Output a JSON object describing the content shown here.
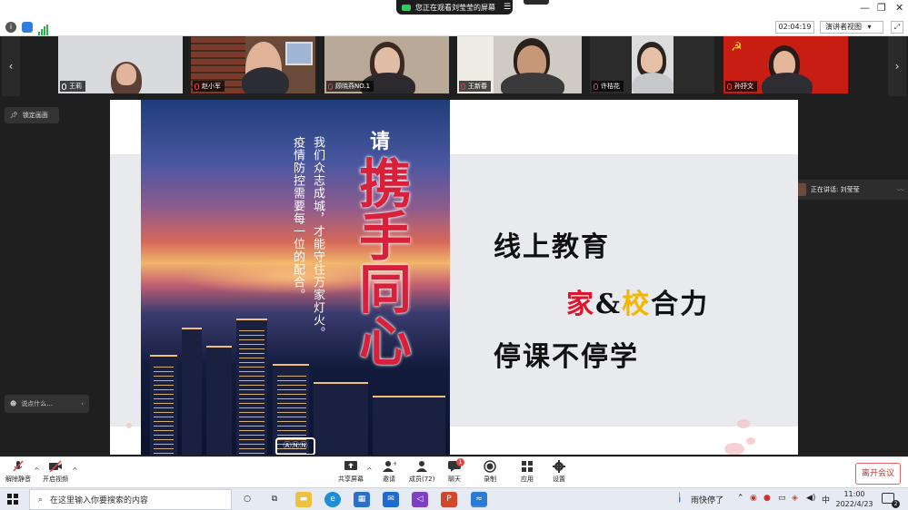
{
  "share_banner": {
    "text": "您正在观看刘莹莹的屏幕",
    "menu_icon": "hamburger-icon"
  },
  "toolbar_top": {
    "timer": "02:04:19",
    "view_label": "演讲者视图"
  },
  "gallery": {
    "participants": [
      {
        "name": "王莉",
        "muted": false,
        "bg": "#d7d9dc"
      },
      {
        "name": "赵小军",
        "muted": true,
        "bg": "#6a4b3a"
      },
      {
        "name": "顾晓燕NO.1",
        "muted": true,
        "bg": "#b9a999"
      },
      {
        "name": "王新春",
        "muted": true,
        "bg": "#c9c4bc"
      },
      {
        "name": "许桔花",
        "muted": true,
        "bg": "#9a9a9a"
      },
      {
        "name": "孙抒文",
        "muted": true,
        "bg": "#c81d12"
      }
    ]
  },
  "lock_view": "锁定画面",
  "chat_placeholder": "说点什么...",
  "speaking": {
    "label": "正在讲话: 刘莹莹"
  },
  "slide": {
    "poster": {
      "qing": "请",
      "call": "携手同心",
      "col1": "我们众志成城，才能守住万家灯火。",
      "col2": "疫情防控需要每一位的配合。",
      "logo": "ⒶⓃⓃ"
    },
    "line1": "线上教育",
    "line2_a": "家",
    "line2_b": "&",
    "line2_c": "校",
    "line2_d": "合力",
    "line3": "停课不停学",
    "colors": {
      "jia": "#e0142a",
      "amp": "#111111",
      "xiao": "#f2b705"
    }
  },
  "meeting_toolbar": {
    "unmute": "解除静音",
    "start_video": "开启视频",
    "share_screen": "共享屏幕",
    "invite": "邀请",
    "members": "成员(72)",
    "chat": "聊天",
    "chat_badge": "1",
    "record": "录制",
    "apps": "应用",
    "settings": "设置",
    "leave": "离开会议"
  },
  "taskbar": {
    "search_placeholder": "在这里输入你要搜索的内容",
    "weather": "雨快停了",
    "ime": "中",
    "time": "11:00",
    "date": "2022/4/23",
    "notif_count": "2"
  }
}
